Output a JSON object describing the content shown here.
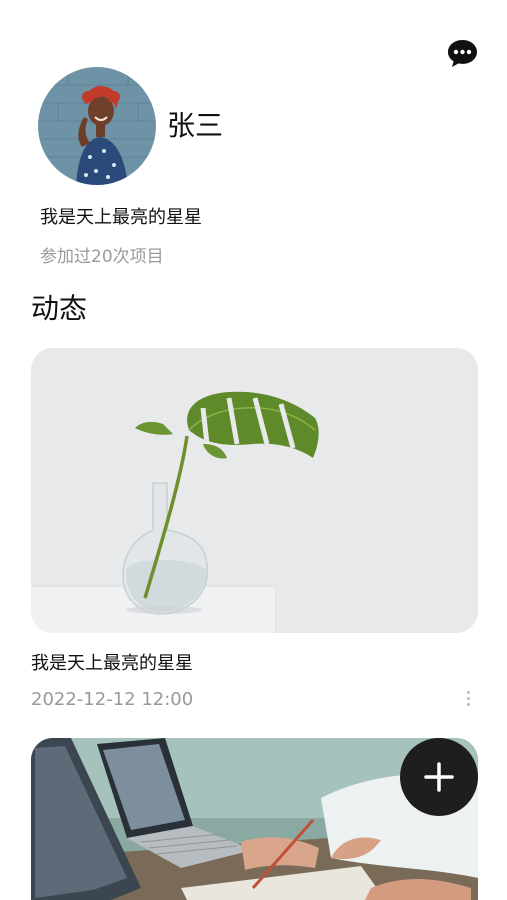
{
  "profile": {
    "name": "张三",
    "bio": "我是天上最亮的星星",
    "participation": "参加过20次项目",
    "avatar_icon": "avatar-photo"
  },
  "header": {
    "chat_icon": "chat-bubble-icon"
  },
  "section": {
    "title": "动态"
  },
  "posts": [
    {
      "text": "我是天上最亮的星星",
      "time": "2022-12-12 12:00",
      "image": "monstera-leaf-in-vase"
    },
    {
      "image": "laptops-on-desk"
    }
  ],
  "fab": {
    "icon": "plus-icon"
  },
  "colors": {
    "text_primary": "#111111",
    "text_secondary": "#999999",
    "fab_bg": "#1e1e1e"
  }
}
